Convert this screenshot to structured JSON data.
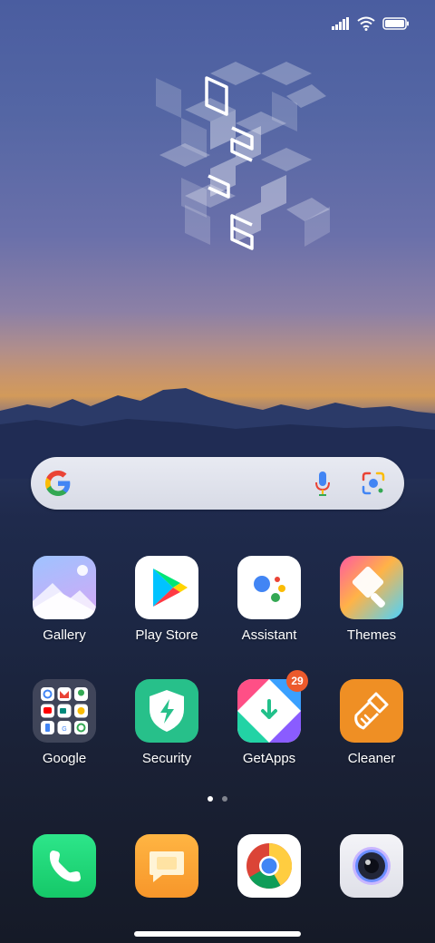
{
  "status_bar": {
    "icons": [
      "signal-icon",
      "wifi-icon",
      "battery-icon"
    ]
  },
  "clock": {
    "digits": [
      "0",
      "2",
      "3",
      "6"
    ]
  },
  "search": {
    "icons": [
      "google-g-icon",
      "mic-icon",
      "lens-icon"
    ]
  },
  "apps": [
    {
      "label": "Gallery"
    },
    {
      "label": "Play Store"
    },
    {
      "label": "Assistant"
    },
    {
      "label": "Themes"
    },
    {
      "label": "Google"
    },
    {
      "label": "Security"
    },
    {
      "label": "GetApps",
      "badge": "29"
    },
    {
      "label": "Cleaner"
    }
  ],
  "pager": {
    "pages": 2,
    "current": 1
  },
  "dock": [
    {
      "name": "phone"
    },
    {
      "name": "messages"
    },
    {
      "name": "chrome"
    },
    {
      "name": "camera"
    }
  ],
  "colors": {
    "badge": "#ec5a2c",
    "phone": "#1fd47a",
    "messages": "#f7a334",
    "security": "#27c08a",
    "cleaner": "#ef8f24"
  }
}
